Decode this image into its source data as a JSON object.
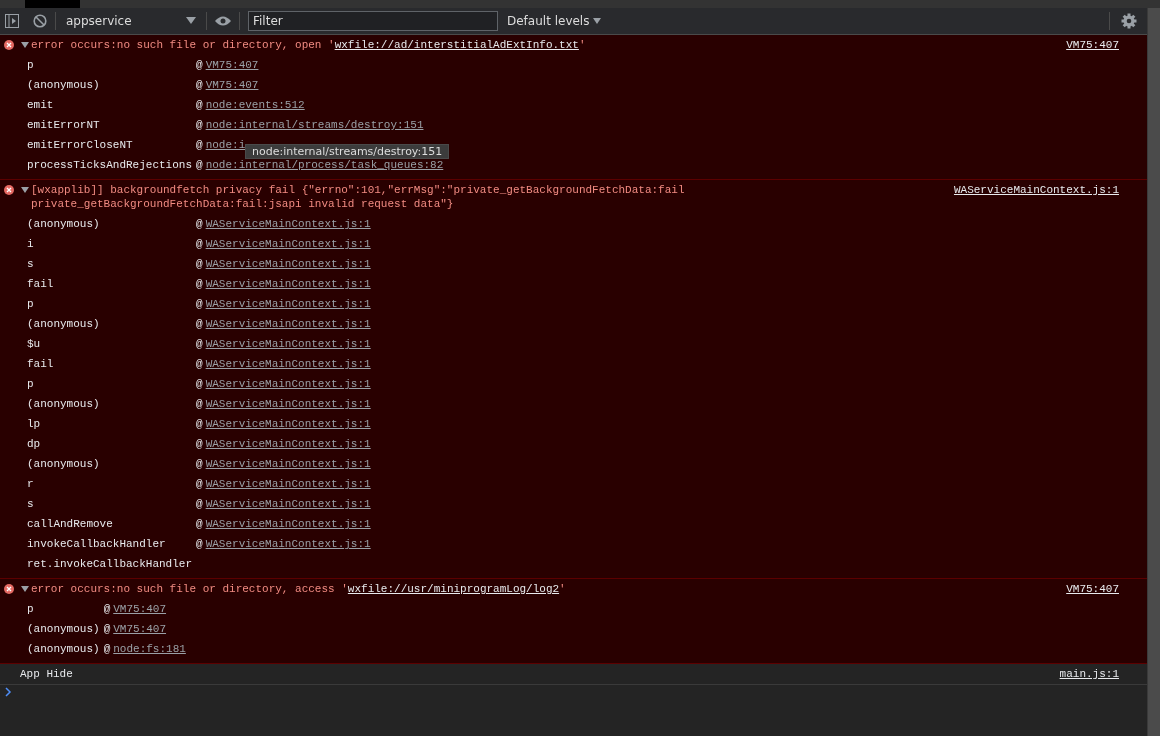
{
  "toolbar": {
    "context": "appservice",
    "filter": {
      "placeholder": "Filter"
    },
    "levels": "Default levels"
  },
  "messages": [
    {
      "kind": "error",
      "expanded": true,
      "text": "error occurs:no such file or directory, open '",
      "link": "wxfile://ad/interstitialAdExtInfo.txt",
      "text_end": "'",
      "source": "VM75:407",
      "frames": [
        {
          "function": "p",
          "at": "@",
          "location": "VM75:407"
        },
        {
          "function": "(anonymous)",
          "at": "@",
          "location": "VM75:407"
        },
        {
          "function": "emit",
          "at": "@",
          "location": "node:events:512"
        },
        {
          "function": "emitErrorNT",
          "at": "@",
          "location": "node:internal/streams/destroy:151"
        },
        {
          "function": "emitErrorCloseNT",
          "at": "@",
          "location": "node:i"
        },
        {
          "function": "processTicksAndRejections",
          "at": "@",
          "location": "node:internal/process/task_queues:82"
        }
      ]
    },
    {
      "kind": "error",
      "expanded": true,
      "text": "[wxapplib]] backgroundfetch privacy fail {\"errno\":101,\"errMsg\":\"private_getBackgroundFetchData:fail private_getBackgroundFetchData:fail:jsapi invalid request data\"}",
      "source": "WAServiceMainContext.js:1",
      "frames": [
        {
          "function": "(anonymous)",
          "at": "@",
          "location": "WAServiceMainContext.js:1"
        },
        {
          "function": "i",
          "at": "@",
          "location": "WAServiceMainContext.js:1"
        },
        {
          "function": "s",
          "at": "@",
          "location": "WAServiceMainContext.js:1"
        },
        {
          "function": "fail",
          "at": "@",
          "location": "WAServiceMainContext.js:1"
        },
        {
          "function": "p",
          "at": "@",
          "location": "WAServiceMainContext.js:1"
        },
        {
          "function": "(anonymous)",
          "at": "@",
          "location": "WAServiceMainContext.js:1"
        },
        {
          "function": "$u",
          "at": "@",
          "location": "WAServiceMainContext.js:1"
        },
        {
          "function": "fail",
          "at": "@",
          "location": "WAServiceMainContext.js:1"
        },
        {
          "function": "p",
          "at": "@",
          "location": "WAServiceMainContext.js:1"
        },
        {
          "function": "(anonymous)",
          "at": "@",
          "location": "WAServiceMainContext.js:1"
        },
        {
          "function": "lp",
          "at": "@",
          "location": "WAServiceMainContext.js:1"
        },
        {
          "function": "dp",
          "at": "@",
          "location": "WAServiceMainContext.js:1"
        },
        {
          "function": "(anonymous)",
          "at": "@",
          "location": "WAServiceMainContext.js:1"
        },
        {
          "function": "r",
          "at": "@",
          "location": "WAServiceMainContext.js:1"
        },
        {
          "function": "s",
          "at": "@",
          "location": "WAServiceMainContext.js:1"
        },
        {
          "function": "callAndRemove",
          "at": "@",
          "location": "WAServiceMainContext.js:1"
        },
        {
          "function": "invokeCallbackHandler",
          "at": "@",
          "location": "WAServiceMainContext.js:1"
        },
        {
          "function": "ret.invokeCallbackHandler"
        }
      ]
    },
    {
      "kind": "error",
      "expanded": true,
      "text": "error occurs:no such file or directory, access '",
      "link": "wxfile://usr/miniprogramLog/log2",
      "text_end": "'",
      "source": "VM75:407",
      "frames": [
        {
          "function": "p",
          "at": "@",
          "location": "VM75:407"
        },
        {
          "function": "(anonymous)",
          "at": "@",
          "location": "VM75:407"
        },
        {
          "function": "(anonymous)",
          "at": "@",
          "location": "node:fs:181"
        }
      ]
    },
    {
      "kind": "info",
      "text": "App Hide",
      "source": "main.js:1"
    }
  ],
  "tooltip": "node:internal/streams/destroy:151"
}
